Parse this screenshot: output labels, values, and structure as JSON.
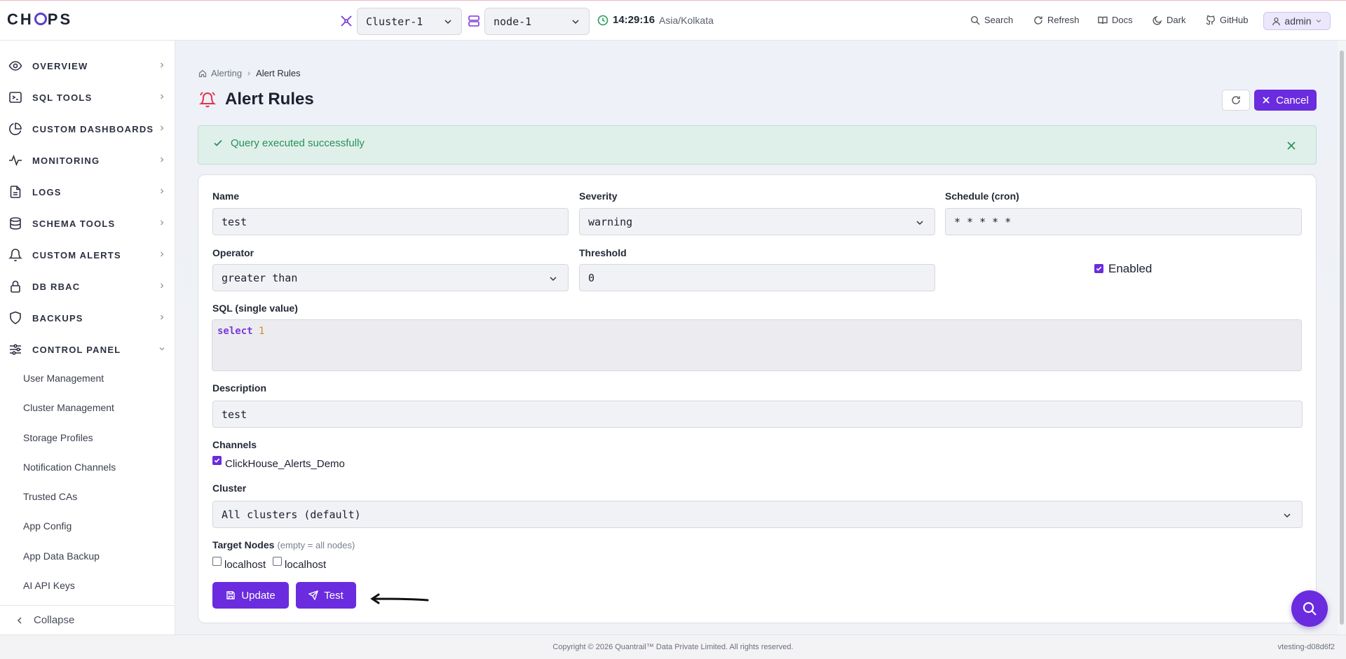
{
  "header": {
    "logo": "CHOPS",
    "cluster_select": "Cluster-1",
    "node_select": "node-1",
    "time": "14:29:16",
    "timezone": "Asia/Kolkata",
    "links": {
      "search": "Search",
      "refresh": "Refresh",
      "docs": "Docs",
      "theme": "Dark",
      "github": "GitHub"
    },
    "user": "admin"
  },
  "sidebar": {
    "items": [
      {
        "label": "OVERVIEW",
        "icon": "eye-icon"
      },
      {
        "label": "SQL TOOLS",
        "icon": "terminal-icon"
      },
      {
        "label": "CUSTOM DASHBOARDS",
        "icon": "pie-chart-icon"
      },
      {
        "label": "MONITORING",
        "icon": "activity-icon"
      },
      {
        "label": "LOGS",
        "icon": "file-text-icon"
      },
      {
        "label": "SCHEMA TOOLS",
        "icon": "database-icon"
      },
      {
        "label": "CUSTOM ALERTS",
        "icon": "bell-icon"
      },
      {
        "label": "DB RBAC",
        "icon": "lock-icon"
      },
      {
        "label": "BACKUPS",
        "icon": "shield-icon"
      },
      {
        "label": "CONTROL PANEL",
        "icon": "sliders-icon"
      }
    ],
    "sub_items": [
      "User Management",
      "Cluster Management",
      "Storage Profiles",
      "Notification Channels",
      "Trusted CAs",
      "App Config",
      "App Data Backup",
      "AI API Keys"
    ],
    "collapse": "Collapse"
  },
  "breadcrumb": {
    "parent": "Alerting",
    "current": "Alert Rules"
  },
  "page": {
    "title": "Alert Rules",
    "cancel_label": "Cancel"
  },
  "alert": {
    "message": "Query executed successfully"
  },
  "form": {
    "name_label": "Name",
    "name_value": "test",
    "severity_label": "Severity",
    "severity_value": "warning",
    "schedule_label": "Schedule (cron)",
    "schedule_value": "* * * * *",
    "operator_label": "Operator",
    "operator_value": "greater than",
    "threshold_label": "Threshold",
    "threshold_value": "0",
    "enabled_label": "Enabled",
    "enabled": true,
    "sql_label": "SQL (single value)",
    "sql_keyword": "select",
    "sql_number": "1",
    "description_label": "Description",
    "description_value": "test",
    "channels_label": "Channels",
    "channel_name": "ClickHouse_Alerts_Demo",
    "cluster_label": "Cluster",
    "cluster_value": "All clusters (default)",
    "target_nodes_label": "Target Nodes",
    "target_nodes_hint": "(empty = all nodes)",
    "node_options": [
      "localhost",
      "localhost"
    ],
    "update_label": "Update",
    "test_label": "Test"
  },
  "footer": {
    "copyright": "Copyright © 2026 Quantrail™ Data Private Limited. All rights reserved.",
    "version": "vtesting-d08d6f2"
  },
  "colors": {
    "accent": "#6a2cde",
    "success_bg": "#dff0ea",
    "success_text": "#2a8f5c",
    "bell": "#e0334f"
  }
}
